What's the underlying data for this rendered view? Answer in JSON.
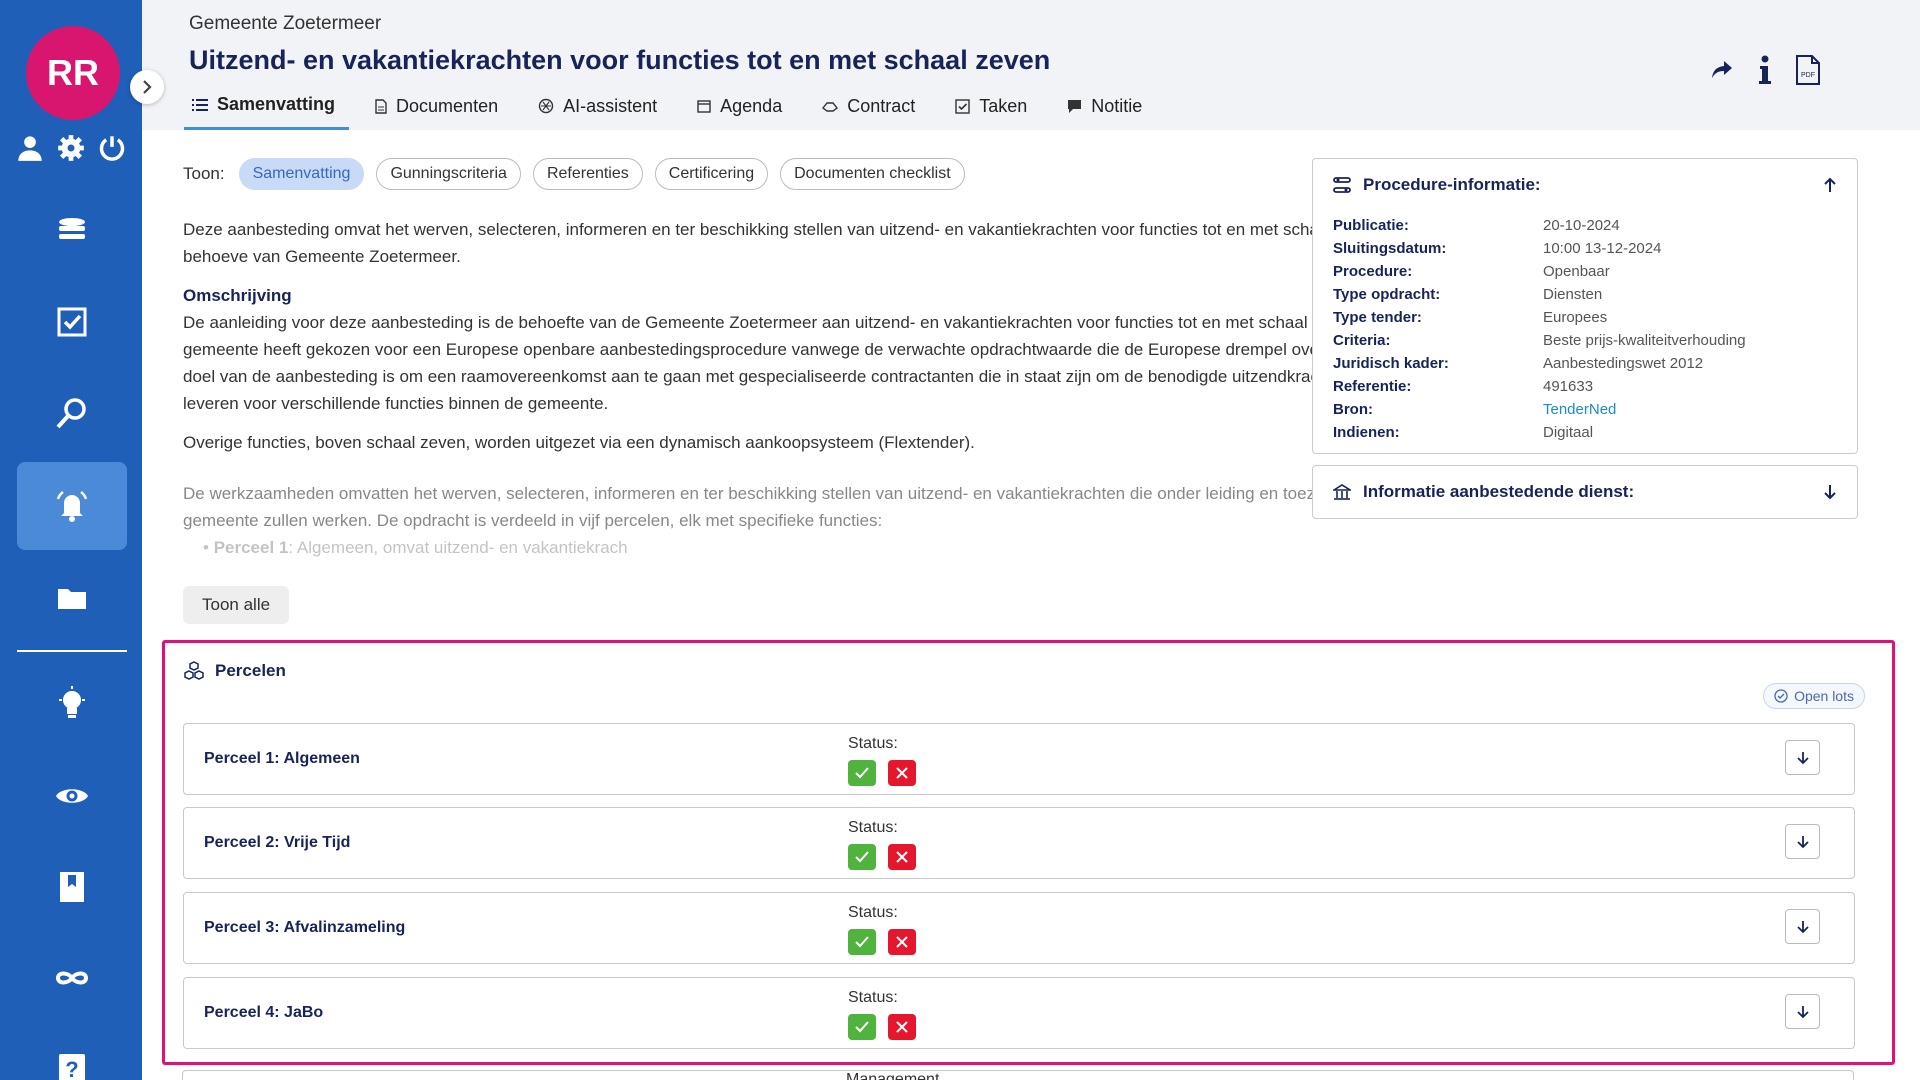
{
  "sidebar": {
    "avatar_initials": "RR",
    "top_icons": [
      "user-icon",
      "gear-icon",
      "power-icon"
    ],
    "nav_icons": [
      "database-icon",
      "checkbox-icon",
      "search-icon",
      "bell-icon",
      "folder-icon",
      "lightbulb-icon",
      "eye-icon",
      "bookmark-icon",
      "infinity-icon",
      "help-icon"
    ],
    "active": "bell-icon",
    "brand_color": "#1f5fb8",
    "active_color": "#4a8ad6",
    "avatar_color": "#d9166f"
  },
  "header": {
    "organisation": "Gemeente Zoetermeer",
    "title": "Uitzend- en vakantiekrachten voor functies tot en met schaal zeven",
    "actions": [
      "share-icon",
      "info-icon",
      "pdf-icon"
    ],
    "tabs": [
      {
        "label": "Samenvatting",
        "icon": "list-icon",
        "active": true
      },
      {
        "label": "Documenten",
        "icon": "document-icon"
      },
      {
        "label": "AI-assistent",
        "icon": "ai-icon"
      },
      {
        "label": "Agenda",
        "icon": "calendar-icon"
      },
      {
        "label": "Contract",
        "icon": "handshake-icon"
      },
      {
        "label": "Taken",
        "icon": "task-icon"
      },
      {
        "label": "Notitie",
        "icon": "note-icon"
      }
    ]
  },
  "toon": {
    "label": "Toon:",
    "filters": [
      "Samenvatting",
      "Gunningscriteria",
      "Referenties",
      "Certificering",
      "Documenten checklist"
    ],
    "active": "Samenvatting"
  },
  "summary": {
    "intro": "Deze aanbesteding omvat het werven, selecteren, informeren en ter beschikking stellen van uitzend- en vakantiekrachten voor functies tot en met schaal zeven ten behoeve van Gemeente Zoetermeer.",
    "heading": "Omschrijving",
    "paragraph1": "De aanleiding voor deze aanbesteding is de behoefte van de Gemeente Zoetermeer aan uitzend- en vakantiekrachten voor functies tot en met schaal zeven. De gemeente heeft gekozen voor een Europese openbare aanbestedingsprocedure vanwege de verwachte opdrachtwaarde die de Europese drempel overschrijdt. Het doel van de aanbesteding is om een raamovereenkomst aan te gaan met gespecialiseerde contractanten die in staat zijn om de benodigde uitzendkrachten te leveren voor verschillende functies binnen de gemeente.",
    "paragraph2": "Overige functies, boven schaal zeven, worden uitgezet via een dynamisch aankoopsysteem (Flextender).",
    "paragraph3": "De werkzaamheden omvatten het werven, selecteren, informeren en ter beschikking stellen van uitzend- en vakantiekrachten die onder leiding en toezicht van de gemeente zullen werken. De opdracht is verdeeld in vijf percelen, elk met specifieke functies:",
    "bullet_bold": "Perceel 1",
    "bullet_text": ": Algemeen, omvat uitzend- en vakantiekrach",
    "show_all": "Toon alle"
  },
  "procedure_info": {
    "title": "Procedure-informatie:",
    "rows": [
      {
        "key": "Publicatie:",
        "value": "20-10-2024"
      },
      {
        "key": "Sluitingsdatum:",
        "value": "10:00 13-12-2024"
      },
      {
        "key": "Procedure:",
        "value": "Openbaar"
      },
      {
        "key": "Type opdracht:",
        "value": "Diensten"
      },
      {
        "key": "Type tender:",
        "value": "Europees"
      },
      {
        "key": "Criteria:",
        "value": "Beste prijs-kwaliteitverhouding"
      },
      {
        "key": "Juridisch kader:",
        "value": "Aanbestedingswet 2012"
      },
      {
        "key": "Referentie:",
        "value": "491633"
      },
      {
        "key": "Bron:",
        "value": "TenderNed"
      },
      {
        "key": "Indienen:",
        "value": "Digitaal"
      }
    ]
  },
  "authority_info": {
    "title": "Informatie aanbestedende dienst:"
  },
  "percelen": {
    "title": "Percelen",
    "open_lots": "Open lots",
    "status_label": "Status:",
    "lots": [
      {
        "name": "Perceel 1: Algemeen"
      },
      {
        "name": "Perceel 2: Vrije Tijd"
      },
      {
        "name": "Perceel 3: Afvalinzameling"
      },
      {
        "name": "Perceel 4: JaBo"
      }
    ],
    "next_lot_status": "Management"
  }
}
